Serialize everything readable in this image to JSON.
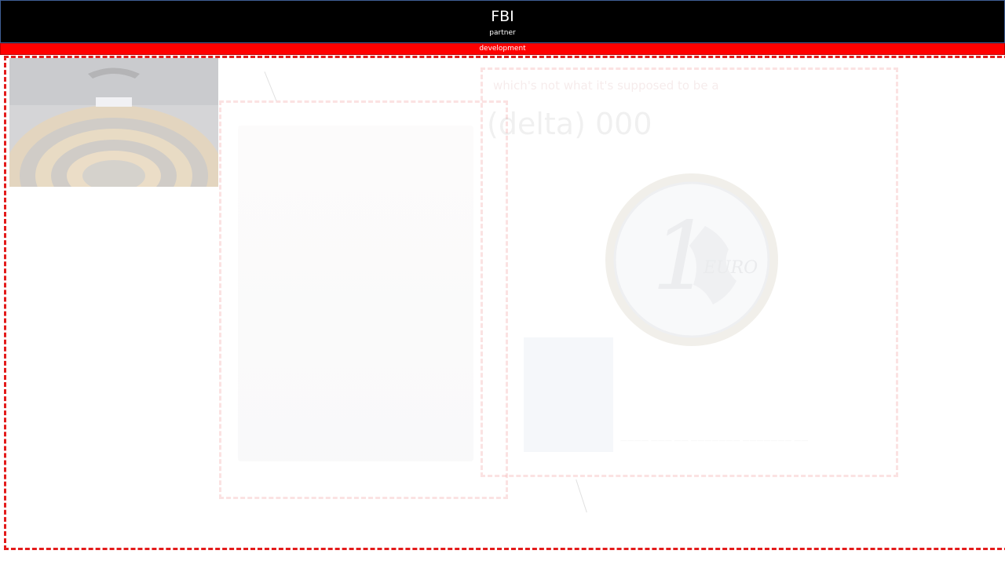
{
  "header": {
    "title": "FBI",
    "subtitle": "partner"
  },
  "banner": {
    "label": "development"
  },
  "ghost": {
    "heading": "which's not what it's supposed to be a",
    "big_text": "(delta) 000",
    "caption": "———— ——— —— ——————— ——————— ——"
  },
  "colors": {
    "header_bg": "#000000",
    "header_border": "#3f5f96",
    "banner_bg": "#ff0000",
    "frame_border": "#e31b1b"
  },
  "images": {
    "parliament": "parliament-hemicycle-photo",
    "coin": "one-euro-coin-image",
    "person": "faded-person-photo",
    "thumb": "faded-thumbnail-photo"
  }
}
